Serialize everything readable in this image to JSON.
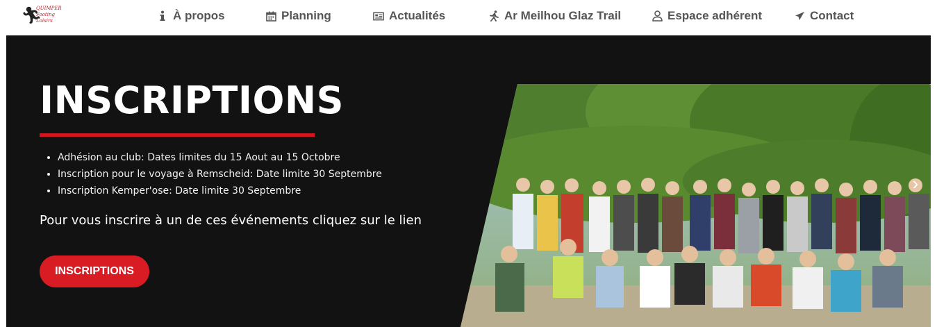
{
  "brand": {
    "logo_lines": [
      "QUIMPER",
      "Footing",
      "Loisirs"
    ]
  },
  "nav": {
    "items": [
      {
        "label": "À propos",
        "icon": "info-icon"
      },
      {
        "label": "Planning",
        "icon": "calendar-icon"
      },
      {
        "label": "Actualités",
        "icon": "newspaper-icon"
      },
      {
        "label": "Ar Meilhou Glaz Trail",
        "icon": "runner-icon"
      },
      {
        "label": "Espace adhérent",
        "icon": "user-icon"
      },
      {
        "label": "Contact",
        "icon": "paper-plane-icon"
      }
    ]
  },
  "hero": {
    "title": "INSCRIPTIONS",
    "bullets": [
      "Adhésion au club: Dates limites du 15 Aout au 15 Octobre",
      "Inscription pour le voyage à Remscheid: Date limite 30 Septembre",
      "Inscription Kemper'ose: Date limite 30 Septembre"
    ],
    "lead": "Pour vous inscrire à un de ces événements cliquez sur le lien",
    "button_label": "INSCRIPTIONS",
    "next_glyph": "›"
  },
  "colors": {
    "accent": "#d91c24",
    "hero_bg": "#121212",
    "nav_text": "#555555"
  }
}
